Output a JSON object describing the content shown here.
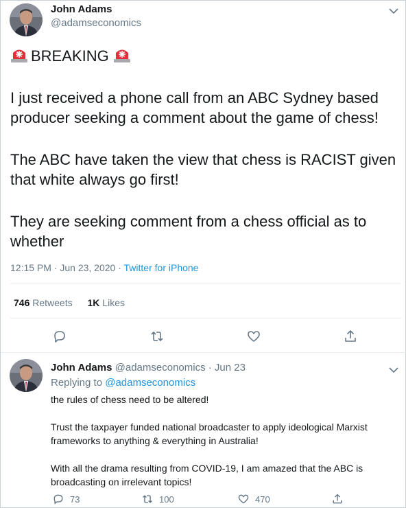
{
  "tweet": {
    "author_name": "John Adams",
    "author_handle": "@adamseconomics",
    "breaking_label": "BREAKING",
    "paragraphs": [
      "I just received a phone call from an ABC Sydney based producer seeking a comment about the game of chess!",
      "The ABC have taken the view that chess is RACIST given that white always go first!",
      "They are seeking comment from a chess official as to whether"
    ],
    "timestamp": "12:15 PM · Jun 23, 2020",
    "separator": " · ",
    "source": "Twitter for iPhone",
    "retweets_count": "746",
    "retweets_label": "Retweets",
    "likes_count": "1K",
    "likes_label": "Likes"
  },
  "reply": {
    "author_name": "John Adams",
    "author_handle": "@adamseconomics",
    "date": "· Jun 23",
    "replying_prefix": "Replying to",
    "replying_to": "@adamseconomics",
    "paragraphs": [
      "the rules of chess need to be altered!",
      "Trust the taxpayer funded national broadcaster to apply ideological Marxist frameworks to anything & everything in Australia!",
      "With all the drama resulting from COVID-19, I am amazed that the ABC is broadcasting on irrelevant topics!"
    ],
    "reply_count": "73",
    "retweet_count": "100",
    "like_count": "470"
  },
  "icons": {
    "siren": "police-car-light-emoji",
    "more": "chevron-down-icon",
    "reply": "speech-bubble-icon",
    "retweet": "retweet-arrows-icon",
    "like": "heart-icon",
    "share": "share-upload-icon"
  },
  "colors": {
    "link": "#1b95e0",
    "muted": "#657786",
    "text": "#14171a",
    "siren_red": "#e0313b"
  }
}
